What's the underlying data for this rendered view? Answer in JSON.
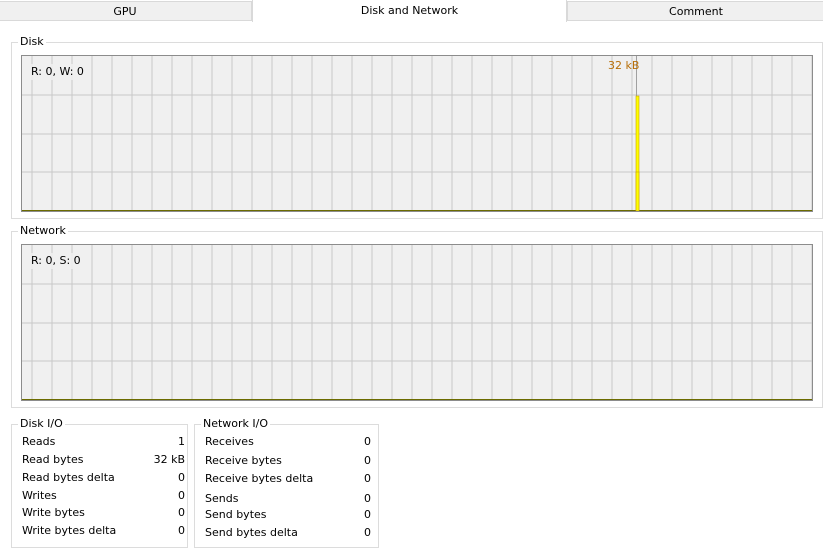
{
  "tabs": [
    {
      "label": "GPU",
      "active": false
    },
    {
      "label": "Disk and Network",
      "active": true
    },
    {
      "label": "Comment",
      "active": false
    }
  ],
  "disk": {
    "group_title": "Disk",
    "graph_label": "R: 0, W: 0",
    "peak_label": "32 kB"
  },
  "network": {
    "group_title": "Network",
    "graph_label": "R: 0, S: 0"
  },
  "disk_io": {
    "title": "Disk I/O",
    "rows": [
      {
        "label": "Reads",
        "value": "1"
      },
      {
        "label": "Read bytes",
        "value": "32 kB"
      },
      {
        "label": "Read bytes delta",
        "value": "0"
      },
      {
        "label": "Writes",
        "value": "0"
      },
      {
        "label": "Write bytes",
        "value": "0"
      },
      {
        "label": "Write bytes delta",
        "value": "0"
      }
    ]
  },
  "network_io": {
    "title": "Network I/O",
    "rows": [
      {
        "label": "Receives",
        "value": "0"
      },
      {
        "label": "Receive bytes",
        "value": "0"
      },
      {
        "label": "Receive bytes delta",
        "value": "0"
      },
      {
        "label": "Sends",
        "value": "0"
      },
      {
        "label": "Send bytes",
        "value": "0"
      },
      {
        "label": "Send bytes delta",
        "value": "0"
      }
    ]
  },
  "colors": {
    "graph_bg": "#f0f0f0",
    "grid": "#c8c8c8",
    "read_fill": "#ffff00",
    "read_line": "#c8a000",
    "baseline": "#6b6b00"
  }
}
